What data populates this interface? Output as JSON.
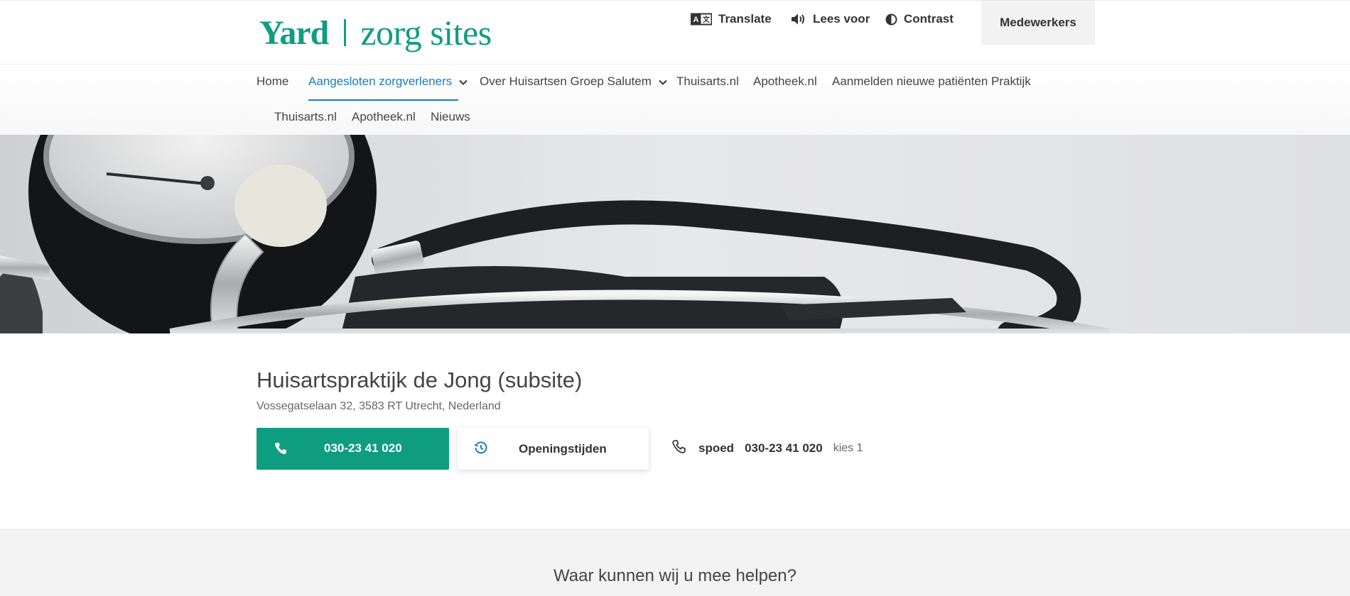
{
  "header": {
    "logo": {
      "brand": "Yard",
      "product": "zorg sites"
    },
    "utilities": [
      {
        "label": "Translate",
        "icon": "translate-icon"
      },
      {
        "label": "Lees voor",
        "icon": "speaker-icon"
      },
      {
        "label": "Contrast",
        "icon": "contrast-icon"
      }
    ],
    "staff_button": "Medewerkers"
  },
  "nav": {
    "row1": [
      {
        "label": "Home"
      },
      {
        "label": "Aangesloten zorgverleners",
        "active": true,
        "has_dropdown": true
      },
      {
        "label": "Over Huisartsen Groep Salutem",
        "has_dropdown": true
      },
      {
        "label": "Thuisarts.nl"
      },
      {
        "label": "Apotheek.nl"
      },
      {
        "label": "Aanmelden nieuwe patiënten Praktijk"
      }
    ],
    "row2": [
      {
        "label": "Thuisarts.nl"
      },
      {
        "label": "Apotheek.nl"
      },
      {
        "label": "Nieuws"
      }
    ]
  },
  "practice": {
    "title": "Huisartspraktijk de Jong (subsite)",
    "address": "Vossegatselaan 32, 3583 RT Utrecht, Nederland",
    "phone_button": "030-23 41 020",
    "hours_button": "Openingstijden",
    "emergency": {
      "label": "spoed",
      "number": "030-23 41 020",
      "note": "kies 1"
    }
  },
  "help": {
    "title": "Waar kunnen wij u mee helpen?"
  },
  "colors": {
    "brand": "#0f9d80",
    "link_active": "#1a7fb8",
    "text": "#333333"
  }
}
